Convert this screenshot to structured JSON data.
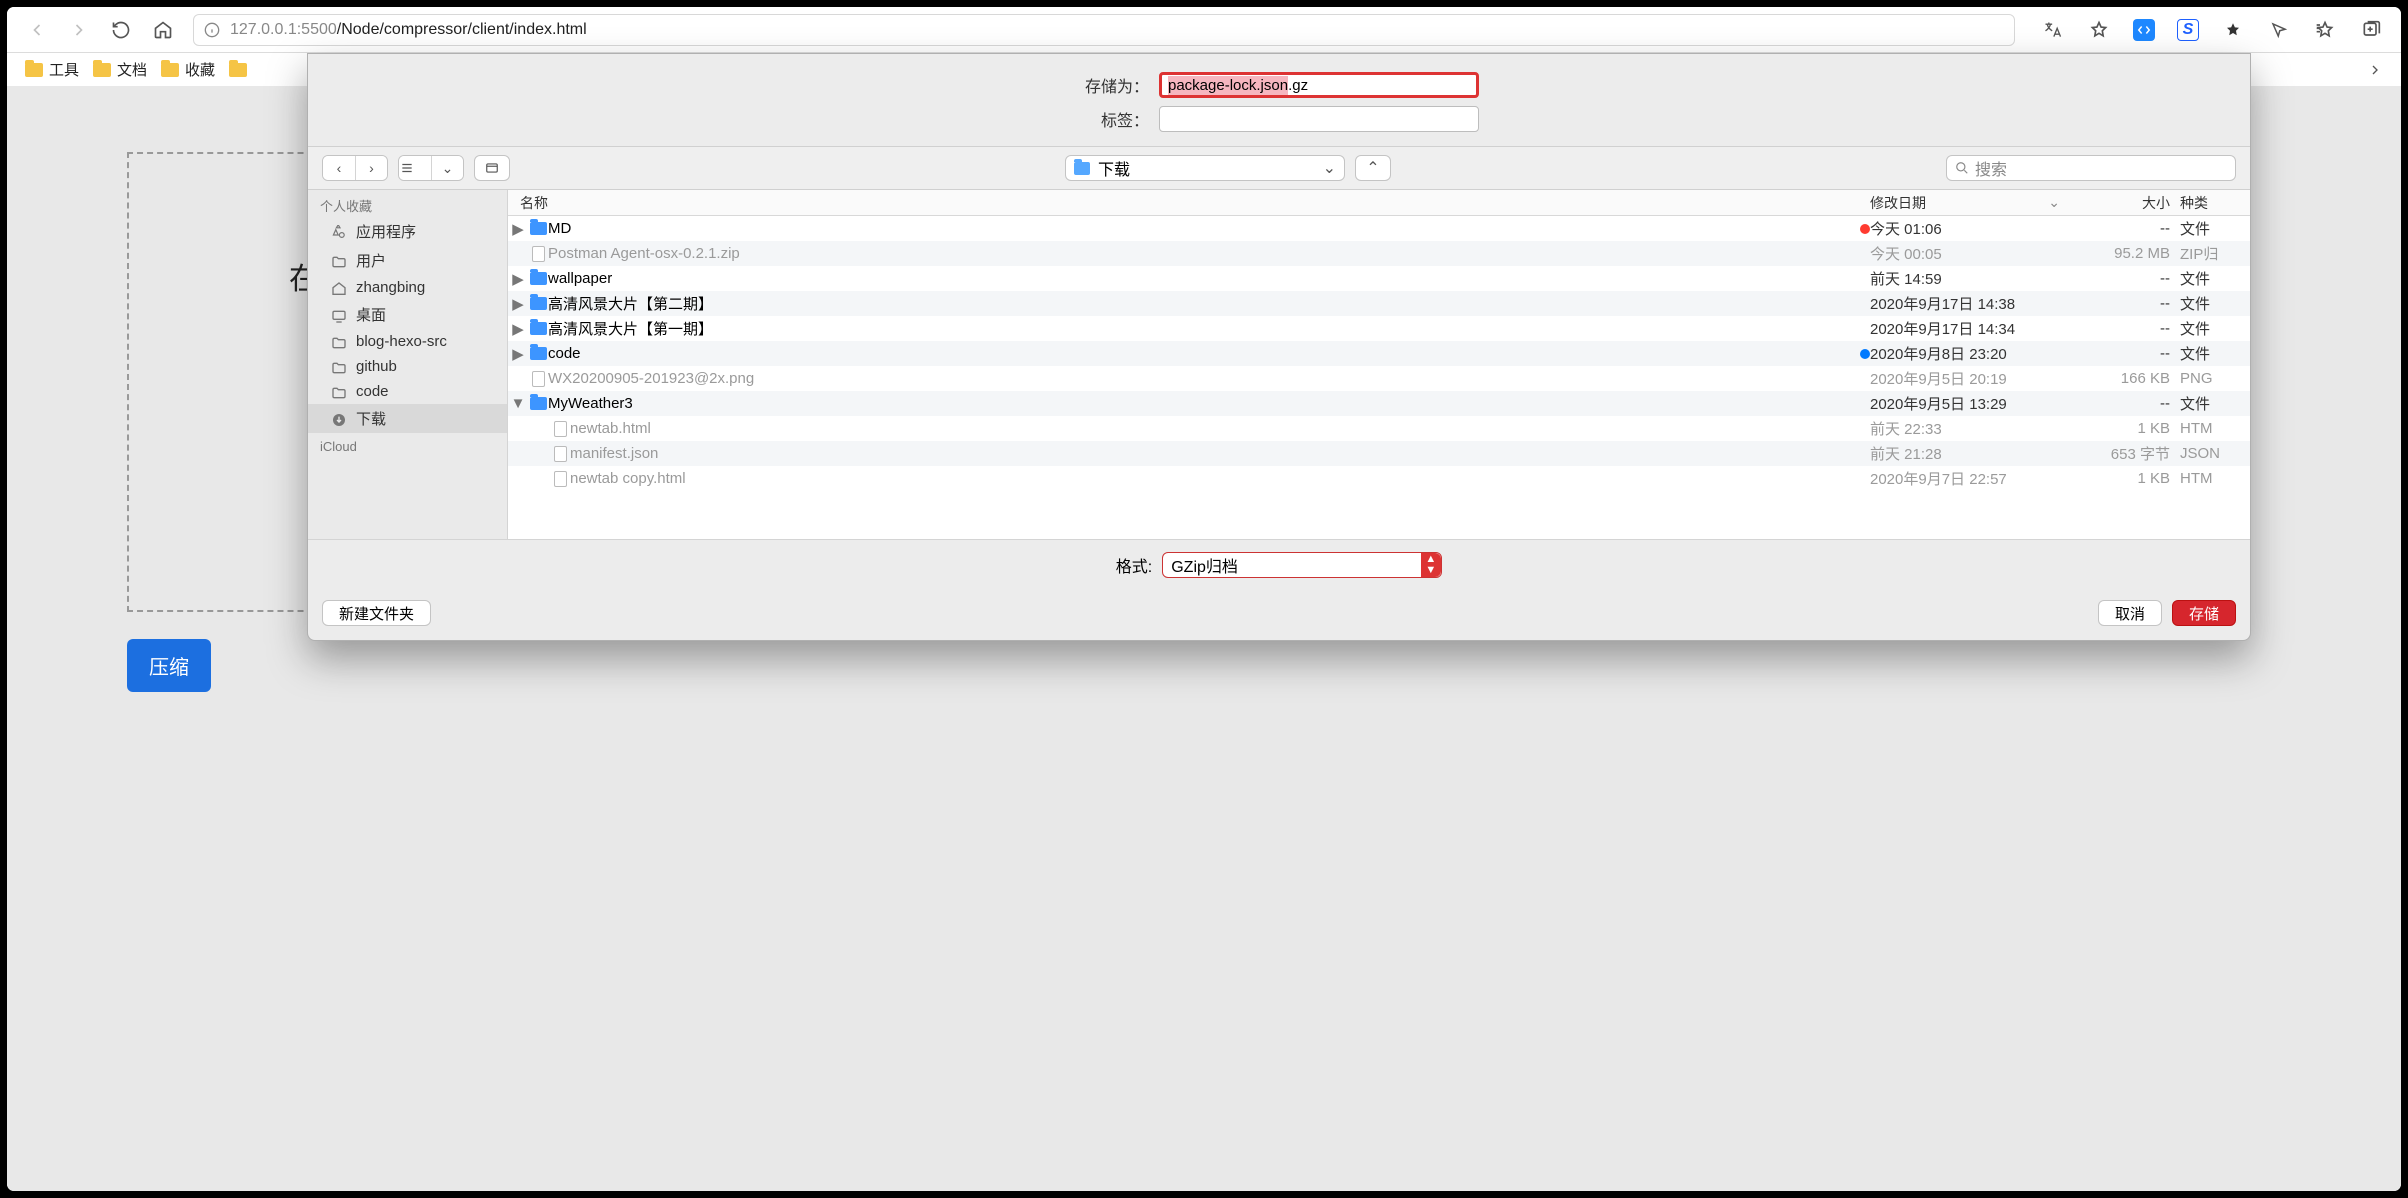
{
  "url": {
    "host": "127.0.0.1",
    "port": ":5500",
    "path": "/Node/compressor/client/index.html"
  },
  "bookmarks": [
    {
      "label": "工具"
    },
    {
      "label": "文档"
    },
    {
      "label": "收藏"
    }
  ],
  "page_body": {
    "dropzone_prefix": "在",
    "compress": "压缩"
  },
  "dialog": {
    "saveas_label": "存储为：",
    "tags_label": "标签：",
    "filename_sel": "package-lock.json",
    "filename_ext": ".gz",
    "location": "下载",
    "search_placeholder": "搜索",
    "sidebar": {
      "favorites_label": "个人收藏",
      "items": [
        {
          "label": "应用程序",
          "icon": "apps"
        },
        {
          "label": "用户",
          "icon": "folder"
        },
        {
          "label": "zhangbing",
          "icon": "home"
        },
        {
          "label": "桌面",
          "icon": "desktop"
        },
        {
          "label": "blog-hexo-src",
          "icon": "folder"
        },
        {
          "label": "github",
          "icon": "folder"
        },
        {
          "label": "code",
          "icon": "folder"
        },
        {
          "label": "下载",
          "icon": "download",
          "selected": true
        }
      ],
      "icloud_label": "iCloud"
    },
    "columns": {
      "name": "名称",
      "date": "修改日期",
      "size": "大小",
      "kind": "种类"
    },
    "rows": [
      {
        "disclose": "▶",
        "icon": "folder",
        "name": "MD",
        "dot": "#ff3b30",
        "date": "今天 01:06",
        "size": "--",
        "kind": "文件"
      },
      {
        "disclose": "",
        "icon": "file",
        "name": "Postman Agent-osx-0.2.1.zip",
        "date": "今天 00:05",
        "size": "95.2 MB",
        "kind": "ZIP归",
        "dim": true
      },
      {
        "disclose": "▶",
        "icon": "folder",
        "name": "wallpaper",
        "date": "前天 14:59",
        "size": "--",
        "kind": "文件"
      },
      {
        "disclose": "▶",
        "icon": "folder",
        "name": "高清风景大片【第二期】",
        "date": "2020年9月17日 14:38",
        "size": "--",
        "kind": "文件"
      },
      {
        "disclose": "▶",
        "icon": "folder",
        "name": "高清风景大片【第一期】",
        "date": "2020年9月17日 14:34",
        "size": "--",
        "kind": "文件"
      },
      {
        "disclose": "▶",
        "icon": "folder",
        "name": "code",
        "dot": "#007aff",
        "date": "2020年9月8日 23:20",
        "size": "--",
        "kind": "文件"
      },
      {
        "disclose": "",
        "icon": "file",
        "name": "WX20200905-201923@2x.png",
        "date": "2020年9月5日 20:19",
        "size": "166 KB",
        "kind": "PNG",
        "dim": true
      },
      {
        "disclose": "▼",
        "icon": "folder",
        "name": "MyWeather3",
        "date": "2020年9月5日 13:29",
        "size": "--",
        "kind": "文件"
      },
      {
        "disclose": "",
        "icon": "file",
        "name": "newtab.html",
        "indent": 1,
        "date": "前天 22:33",
        "size": "1 KB",
        "kind": "HTM",
        "dim": true
      },
      {
        "disclose": "",
        "icon": "file",
        "name": "manifest.json",
        "indent": 1,
        "date": "前天 21:28",
        "size": "653 字节",
        "kind": "JSON",
        "dim": true
      },
      {
        "disclose": "",
        "icon": "file",
        "name": "newtab copy.html",
        "indent": 1,
        "date": "2020年9月7日 22:57",
        "size": "1 KB",
        "kind": "HTM",
        "dim": true
      }
    ],
    "format_label": "格式:",
    "format_value": "GZip归档",
    "new_folder": "新建文件夹",
    "cancel": "取消",
    "save": "存储"
  }
}
